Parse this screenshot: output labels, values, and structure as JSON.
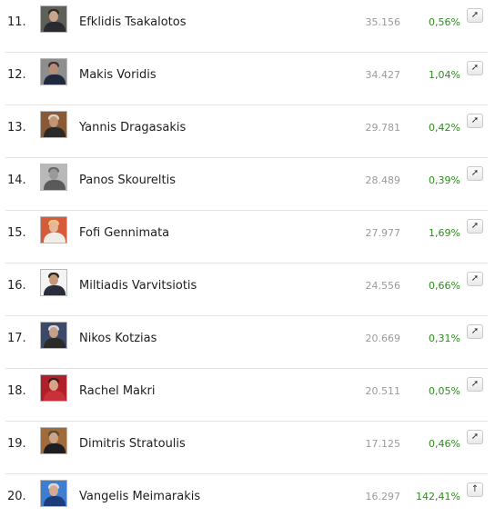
{
  "rows": [
    {
      "rank": "11.",
      "name": "Efklidis Tsakalotos",
      "votes": "35.156",
      "pct": "0,56%",
      "trend_icon": "arrow-up-right-icon",
      "trend_glyph": "➚",
      "photo": {
        "bg": "#5f6158",
        "hair": "#2b2a27",
        "skin": "#caa48c",
        "clothes": "#2a2b30"
      }
    },
    {
      "rank": "12.",
      "name": "Makis Voridis",
      "votes": "34.427",
      "pct": "1,04%",
      "trend_icon": "arrow-up-right-icon",
      "trend_glyph": "➚",
      "photo": {
        "bg": "#8e8e8e",
        "hair": "#3a3230",
        "skin": "#b88d77",
        "clothes": "#1f2a40"
      }
    },
    {
      "rank": "13.",
      "name": "Yannis Dragasakis",
      "votes": "29.781",
      "pct": "0,42%",
      "trend_icon": "arrow-up-right-icon",
      "trend_glyph": "➚",
      "photo": {
        "bg": "#8a5a36",
        "hair": "#d9d4cc",
        "skin": "#c39474",
        "clothes": "#2c2a28"
      }
    },
    {
      "rank": "14.",
      "name": "Panos Skoureltis",
      "votes": "28.489",
      "pct": "0,39%",
      "trend_icon": "arrow-up-right-icon",
      "trend_glyph": "➚",
      "photo": {
        "bg": "#b8b8b8",
        "hair": "#6a6a6a",
        "skin": "#9a9a9a",
        "clothes": "#5a5a5a"
      }
    },
    {
      "rank": "15.",
      "name": "Fofi Gennimata",
      "votes": "27.977",
      "pct": "1,69%",
      "trend_icon": "arrow-up-right-icon",
      "trend_glyph": "➚",
      "photo": {
        "bg": "#d75a3a",
        "hair": "#e8c97a",
        "skin": "#e6b79a",
        "clothes": "#f1eee8"
      }
    },
    {
      "rank": "16.",
      "name": "Miltiadis Varvitsiotis",
      "votes": "24.556",
      "pct": "0,66%",
      "trend_icon": "arrow-up-right-icon",
      "trend_glyph": "➚",
      "photo": {
        "bg": "#f4f4f4",
        "hair": "#2a2420",
        "skin": "#c4987a",
        "clothes": "#2a2d3a"
      }
    },
    {
      "rank": "17.",
      "name": "Nikos Kotzias",
      "votes": "20.669",
      "pct": "0,31%",
      "trend_icon": "arrow-up-right-icon",
      "trend_glyph": "➚",
      "photo": {
        "bg": "#3c4a6a",
        "hair": "#d8d8d8",
        "skin": "#c4a08a",
        "clothes": "#2a2a2a"
      }
    },
    {
      "rank": "18.",
      "name": "Rachel Makri",
      "votes": "20.511",
      "pct": "0,05%",
      "trend_icon": "arrow-up-right-icon",
      "trend_glyph": "➚",
      "photo": {
        "bg": "#b11f2a",
        "hair": "#3a1e16",
        "skin": "#d7a489",
        "clothes": "#c8303a"
      }
    },
    {
      "rank": "19.",
      "name": "Dimitris Stratoulis",
      "votes": "17.125",
      "pct": "0,46%",
      "trend_icon": "arrow-up-right-icon",
      "trend_glyph": "➚",
      "photo": {
        "bg": "#a06a3a",
        "hair": "#5a4a3a",
        "skin": "#c9a58a",
        "clothes": "#1e1e22"
      }
    },
    {
      "rank": "20.",
      "name": "Vangelis Meimarakis",
      "votes": "16.297",
      "pct": "142,41%",
      "trend_icon": "arrow-up-icon",
      "trend_glyph": "↑",
      "photo": {
        "bg": "#3d7ed0",
        "hair": "#dcdcdc",
        "skin": "#d6aa8e",
        "clothes": "#1f3c7a"
      }
    }
  ]
}
